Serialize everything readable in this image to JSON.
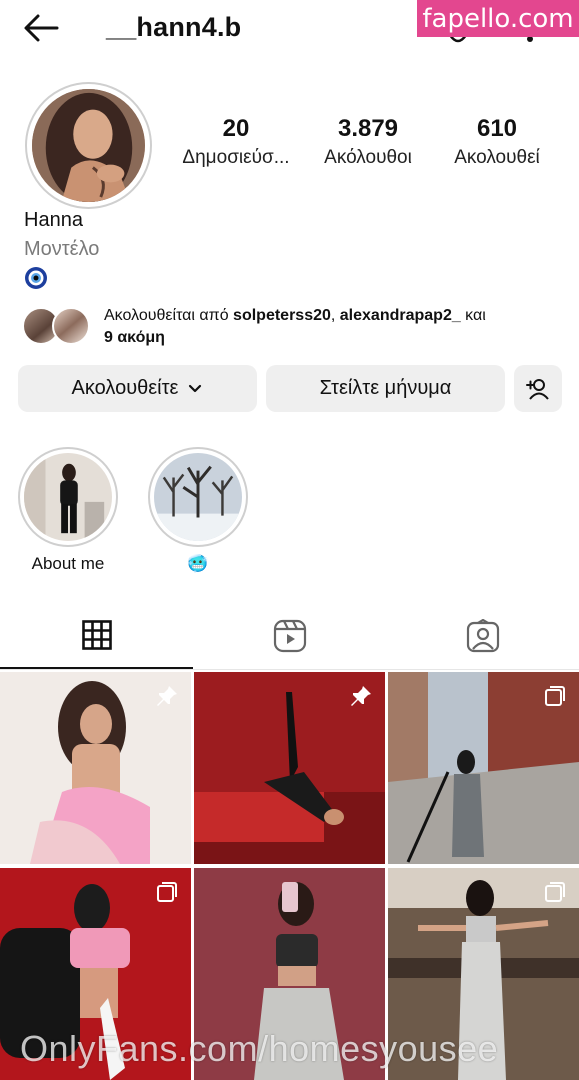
{
  "header": {
    "username": "__hann4.b",
    "watermark": "fapello.com"
  },
  "profile": {
    "name": "Hanna",
    "category": "Μοντέλο",
    "bio_icon": "nazar-eye-icon",
    "stats": [
      {
        "value": "20",
        "label": "Δημοσιεύσ..."
      },
      {
        "value": "3.879",
        "label": "Ακόλουθοι"
      },
      {
        "value": "610",
        "label": "Ακολουθεί"
      }
    ],
    "followed_by": {
      "prefix": "Ακολουθείται από ",
      "user1": "solpeterss20",
      "sep": ", ",
      "user2": "alexandrapap2_",
      "suffix": " και",
      "more": "9 ακόμη"
    }
  },
  "actions": {
    "follow_label": "Ακολουθείτε",
    "message_label": "Στείλτε μήνυμα"
  },
  "highlights": [
    {
      "label": "About me"
    },
    {
      "label": "🥶"
    }
  ],
  "tabs": [
    "grid-icon",
    "reels-icon",
    "tagged-icon"
  ],
  "overlay_watermark": "OnlyFans.com/homesyousee",
  "colors": {
    "watermark_bg": "#e3478f",
    "button_bg": "#efefef",
    "muted_text": "#7a7a7a"
  }
}
